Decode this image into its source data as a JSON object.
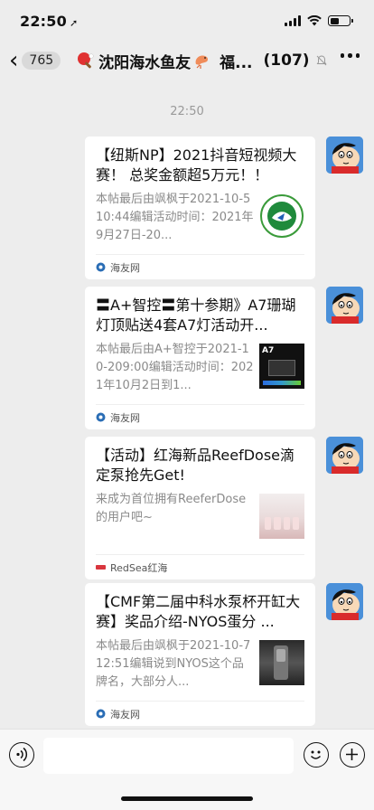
{
  "status": {
    "time": "22:50",
    "location_icon": "location-arrow-icon"
  },
  "nav": {
    "unread_count": "765",
    "title": "沈阳海水鱼友",
    "title_suffix": "福...",
    "member_count": "(107)",
    "icons": [
      "back-chevron-icon",
      "ping-pong-paddle-icon",
      "shrimp-icon",
      "mute-bell-icon",
      "more-dots-icon"
    ]
  },
  "chat": {
    "timestamp": "22:50",
    "messages": [
      {
        "title": "【纽斯NP】2021抖音短视频大赛！ 总奖金额超5万元！！",
        "desc": "本帖最后由飒枫于2021-10-510:44编辑活动时间：2021年9月27日-20...",
        "source": "海友网",
        "thumb": "np-logo-icon"
      },
      {
        "title": "〓A+智控〓第十参期》A7珊瑚灯顶贴送4套A7灯活动开...",
        "desc": "本帖最后由A+智控于2021-10-209:00编辑活动时间：2021年10月2日到1...",
        "source": "海友网",
        "thumb": "a7-light-image",
        "thumb_label": "A7"
      },
      {
        "title": "【活动】红海新品ReefDose滴定泵抢先Get!",
        "desc": "来成为首位拥有ReeferDose的用户吧~",
        "source": "RedSea红海",
        "thumb": "reefdose-image"
      },
      {
        "title": "【CMF第二届中科水泵杯开缸大赛】奖品介绍-NYOS蛋分 ...",
        "desc": "本帖最后由飒枫于2021-10-712:51编辑说到NYOS这个品牌名，大部分人...",
        "source": "海友网",
        "thumb": "nyos-skimmer-image"
      }
    ]
  },
  "input": {
    "placeholder": "",
    "icons": [
      "voice-icon",
      "emoji-icon",
      "plus-icon"
    ]
  },
  "colors": {
    "background": "#ededed",
    "card": "#ffffff",
    "muted_text": "#8a8a8a",
    "avatar_bg": "#4a90d9"
  }
}
